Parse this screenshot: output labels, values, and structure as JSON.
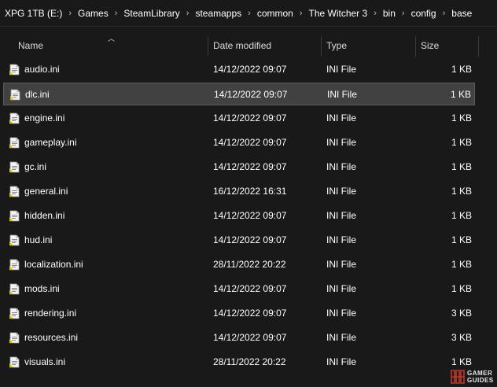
{
  "breadcrumb": [
    "XPG 1TB (E:)",
    "Games",
    "SteamLibrary",
    "steamapps",
    "common",
    "The Witcher 3",
    "bin",
    "config",
    "base"
  ],
  "columns": {
    "name": "Name",
    "date": "Date modified",
    "type": "Type",
    "size": "Size"
  },
  "files": [
    {
      "name": "audio.ini",
      "date": "14/12/2022 09:07",
      "type": "INI File",
      "size": "1 KB"
    },
    {
      "name": "dlc.ini",
      "date": "14/12/2022 09:07",
      "type": "INI File",
      "size": "1 KB",
      "selected": true
    },
    {
      "name": "engine.ini",
      "date": "14/12/2022 09:07",
      "type": "INI File",
      "size": "1 KB"
    },
    {
      "name": "gameplay.ini",
      "date": "14/12/2022 09:07",
      "type": "INI File",
      "size": "1 KB"
    },
    {
      "name": "gc.ini",
      "date": "14/12/2022 09:07",
      "type": "INI File",
      "size": "1 KB"
    },
    {
      "name": "general.ini",
      "date": "16/12/2022 16:31",
      "type": "INI File",
      "size": "1 KB"
    },
    {
      "name": "hidden.ini",
      "date": "14/12/2022 09:07",
      "type": "INI File",
      "size": "1 KB"
    },
    {
      "name": "hud.ini",
      "date": "14/12/2022 09:07",
      "type": "INI File",
      "size": "1 KB"
    },
    {
      "name": "localization.ini",
      "date": "28/11/2022 20:22",
      "type": "INI File",
      "size": "1 KB"
    },
    {
      "name": "mods.ini",
      "date": "14/12/2022 09:07",
      "type": "INI File",
      "size": "1 KB"
    },
    {
      "name": "rendering.ini",
      "date": "14/12/2022 09:07",
      "type": "INI File",
      "size": "3 KB"
    },
    {
      "name": "resources.ini",
      "date": "14/12/2022 09:07",
      "type": "INI File",
      "size": "3 KB"
    },
    {
      "name": "visuals.ini",
      "date": "28/11/2022 20:22",
      "type": "INI File",
      "size": "1 KB"
    }
  ],
  "watermark": {
    "line1": "GAMER",
    "line2": "GUIDES"
  }
}
